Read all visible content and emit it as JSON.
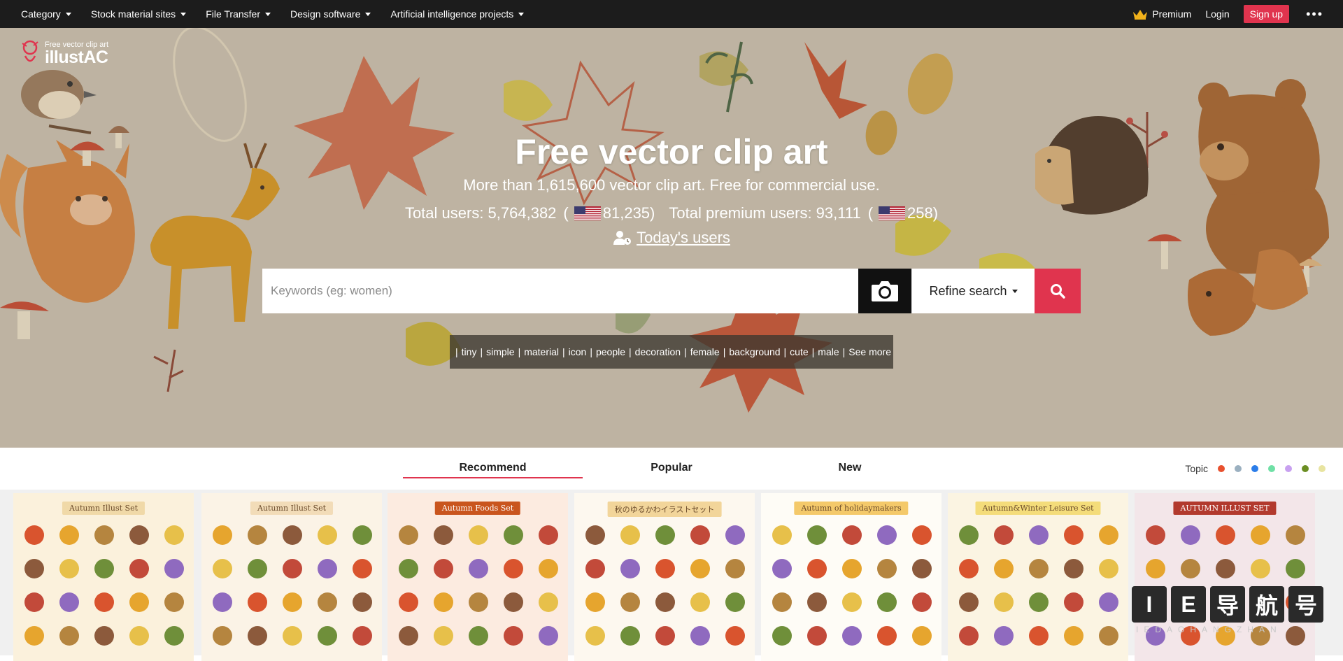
{
  "nav": {
    "left": [
      {
        "label": "Category"
      },
      {
        "label": "Stock material sites"
      },
      {
        "label": "File Transfer"
      },
      {
        "label": "Design software"
      },
      {
        "label": "Artificial intelligence projects"
      }
    ],
    "premium": "Premium",
    "login": "Login",
    "signup": "Sign up"
  },
  "logo": {
    "sub": "Free vector clip art",
    "main": "illustAC"
  },
  "hero": {
    "title": "Free vector clip art",
    "subtitle": "More than 1,615,600 vector clip art. Free for commercial use.",
    "total_users_label": "Total users: 5,764,382",
    "total_users_us": "81,235)",
    "premium_users_label": "Total premium users: 93,111",
    "premium_users_us": "258)",
    "open_paren": "(",
    "today_users": "Today's users"
  },
  "search": {
    "placeholder": "Keywords (eg: women)",
    "refine": "Refine search"
  },
  "tags": [
    "tiny",
    "simple",
    "material",
    "icon",
    "people",
    "decoration",
    "female",
    "background",
    "cute",
    "male",
    "See more"
  ],
  "tabs": [
    "Recommend",
    "Popular",
    "New"
  ],
  "topic": {
    "label": "Topic",
    "colors": [
      "#e8502e",
      "#9bb0c0",
      "#2b7de9",
      "#6fe0a6",
      "#c8a0f0",
      "#6b8e23",
      "#e8e4a0"
    ]
  },
  "cards": [
    {
      "title": "Autumn Illust Set",
      "bg": "#fbf1dc",
      "banner": "#f0d9a8"
    },
    {
      "title": "Autumn Illust Set",
      "bg": "#fbf3e6",
      "banner": "#f2dcb8"
    },
    {
      "title": "Autumn Foods Set",
      "bg": "#fcebe0",
      "banner": "#c9551e"
    },
    {
      "title": "秋のゆるかわイラストセット",
      "bg": "#fdf8ef",
      "banner": "#f2d59a"
    },
    {
      "title": "Autumn of holidaymakers",
      "bg": "#fefcf6",
      "banner": "#f4c96a"
    },
    {
      "title": "Autumn&Winter Leisure Set",
      "bg": "#fbf4e2",
      "banner": "#f4dc7a"
    },
    {
      "title": "AUTUMN ILLUST SET",
      "bg": "#f3e6e9",
      "banner": "#b23a2e"
    }
  ],
  "watermark": {
    "chars": [
      "I",
      "E",
      "导",
      "航",
      "号"
    ],
    "sub": "IEDAOHANGZHAN"
  }
}
